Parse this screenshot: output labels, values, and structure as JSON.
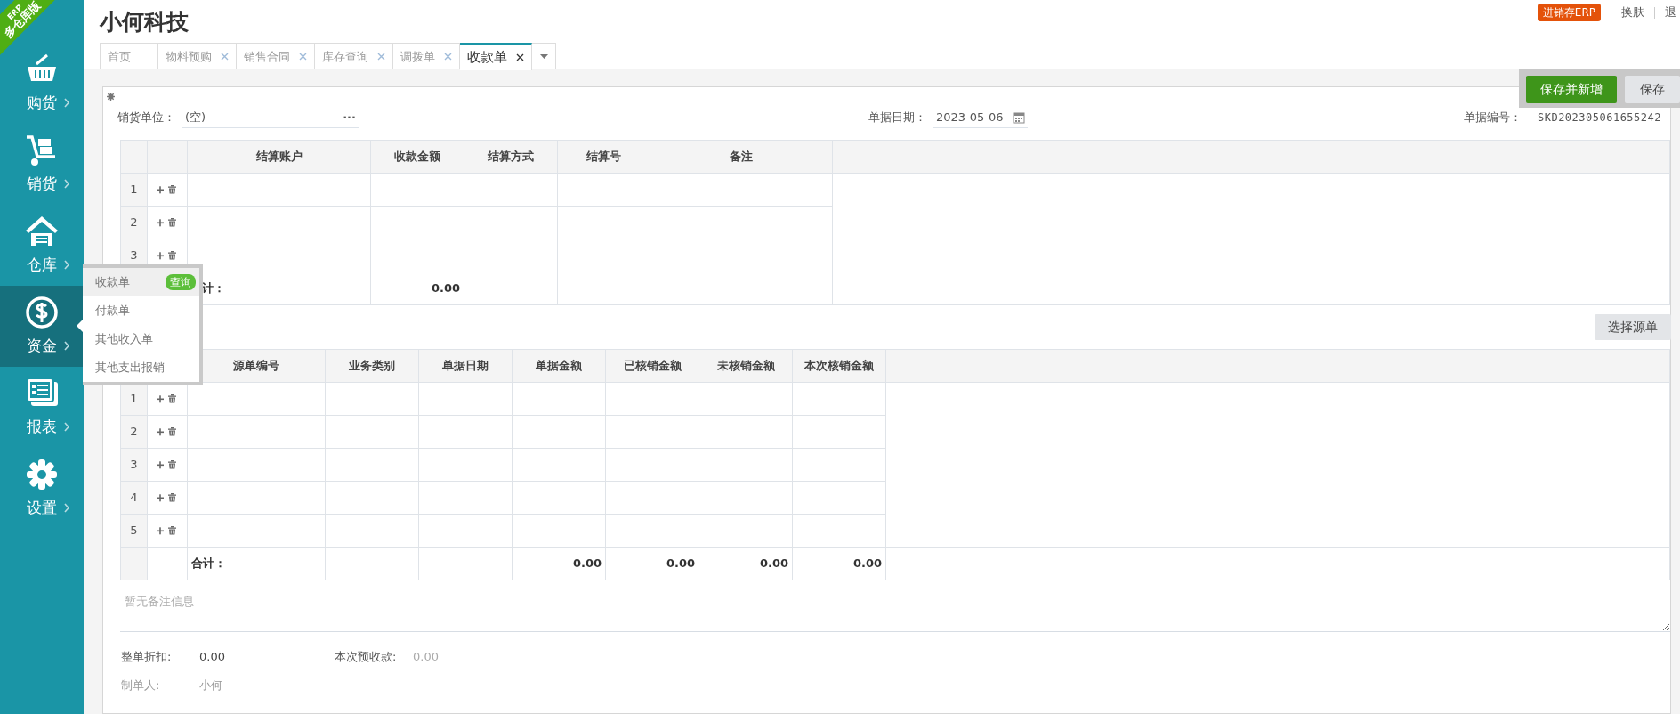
{
  "brand_ribbon": {
    "edition": "ERP",
    "title": "多仓库版"
  },
  "sidebar": {
    "items": [
      {
        "label": "购货",
        "selected": false
      },
      {
        "label": "销货",
        "selected": false
      },
      {
        "label": "仓库",
        "selected": false
      },
      {
        "label": "资金",
        "selected": true
      },
      {
        "label": "报表",
        "selected": false
      },
      {
        "label": "设置",
        "selected": false
      }
    ]
  },
  "flyout": {
    "items": [
      {
        "label": "收款单",
        "selected": true,
        "badge": "查询"
      },
      {
        "label": "付款单",
        "selected": false
      },
      {
        "label": "其他收入单",
        "selected": false
      },
      {
        "label": "其他支出报销",
        "selected": false
      }
    ]
  },
  "header": {
    "title": "小何科技",
    "badge": "进销存ERP",
    "links": [
      "换肤",
      "退"
    ]
  },
  "tabs": [
    {
      "label": "首页",
      "closable": false,
      "selected": false
    },
    {
      "label": "物料预购",
      "closable": true,
      "selected": false
    },
    {
      "label": "销售合同",
      "closable": true,
      "selected": false
    },
    {
      "label": "库存查询",
      "closable": true,
      "selected": false
    },
    {
      "label": "调拨单",
      "closable": true,
      "selected": false
    },
    {
      "label": "收款单",
      "closable": true,
      "selected": true
    }
  ],
  "toolbar": {
    "buttons": [
      {
        "label": "保存并新增",
        "kind": "primary"
      },
      {
        "label": "保存",
        "kind": "secondary"
      }
    ]
  },
  "supplier": {
    "label": "销货单位：",
    "value": "(空)",
    "more": "···"
  },
  "doc_date": {
    "label": "单据日期：",
    "value": "2023-05-06"
  },
  "doc_number": {
    "label": "单据编号：",
    "value": "SKD202305061655242"
  },
  "settlement_table": {
    "columns": [
      {
        "title": "结算账户",
        "total": "计："
      },
      {
        "title": "收款金额",
        "total": "0.00"
      },
      {
        "title": "结算方式"
      },
      {
        "title": "结算号"
      },
      {
        "title": "备注"
      }
    ],
    "rows": [
      {
        "index": "1"
      },
      {
        "index": "2"
      },
      {
        "index": "3"
      }
    ]
  },
  "select_source_button": "选择源单",
  "source_table": {
    "columns": [
      {
        "title": "源单编号",
        "total": "合计："
      },
      {
        "title": "业务类别"
      },
      {
        "title": "单据日期"
      },
      {
        "title": "单据金额",
        "total": "0.00"
      },
      {
        "title": "已核销金额",
        "total": "0.00"
      },
      {
        "title": "未核销金额",
        "total": "0.00"
      },
      {
        "title": "本次核销金额",
        "total": "0.00"
      }
    ],
    "rows": [
      {
        "index": "1"
      },
      {
        "index": "2"
      },
      {
        "index": "3"
      },
      {
        "index": "4"
      },
      {
        "index": "5"
      }
    ]
  },
  "remarks": {
    "placeholder": "暂无备注信息"
  },
  "footer": {
    "discount": {
      "label": "整单折扣:",
      "value": "0.00",
      "disabled": false
    },
    "prepayment": {
      "label": "本次预收款:",
      "value": "0.00",
      "disabled": true
    },
    "creator": {
      "label": "制单人:",
      "value": "小何"
    }
  }
}
